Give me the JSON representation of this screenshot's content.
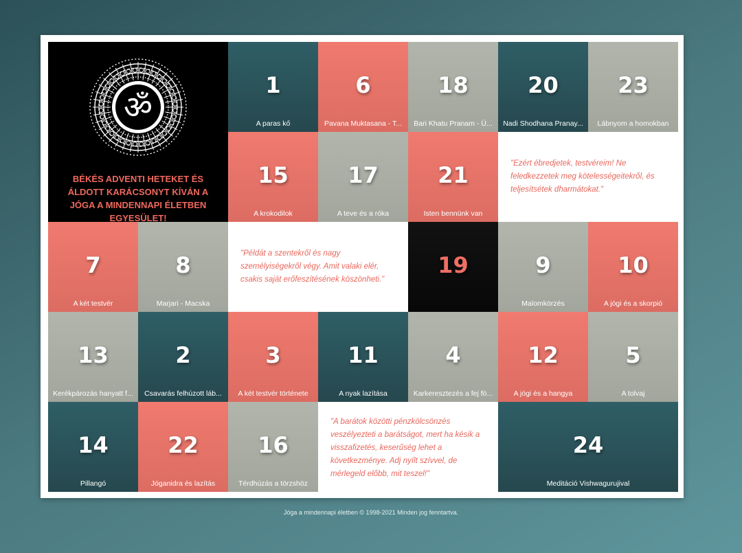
{
  "hero": {
    "logo_icon": "om-mandala-icon",
    "text": "BÉKÉS ADVENTI HETEKET ÉS ÁLDOTT KARÁCSONYT KÍVÁN A JÓGA A MINDENNAPI ÉLETBEN EGYESÜLET!"
  },
  "tiles": [
    {
      "number": "1",
      "label": "A paras kő",
      "color": "teal"
    },
    {
      "number": "6",
      "label": "Pavana Muktasana - T...",
      "color": "coral"
    },
    {
      "number": "18",
      "label": "Bari Khatu Pranam - Ü...",
      "color": "gray"
    },
    {
      "number": "20",
      "label": "Nadi Shodhana Pranay...",
      "color": "teal"
    },
    {
      "number": "23",
      "label": "Lábnyom a homokban",
      "color": "gray"
    },
    {
      "number": "15",
      "label": "A krokodilok",
      "color": "coral"
    },
    {
      "number": "17",
      "label": "A teve és a róka",
      "color": "gray"
    },
    {
      "number": "21",
      "label": "Isten bennünk van",
      "color": "coral"
    },
    {
      "number": "7",
      "label": "A két testvér",
      "color": "coral"
    },
    {
      "number": "8",
      "label": "Marjari - Macska",
      "color": "gray"
    },
    {
      "number": "19",
      "label": "",
      "color": "dark"
    },
    {
      "number": "9",
      "label": "Malomkörzés",
      "color": "gray"
    },
    {
      "number": "10",
      "label": "A jógi és a skorpió",
      "color": "coral"
    },
    {
      "number": "13",
      "label": "Kerékpározás hanyatt f...",
      "color": "gray"
    },
    {
      "number": "2",
      "label": "Csavarás felhúzott láb...",
      "color": "teal"
    },
    {
      "number": "3",
      "label": "A két testvér története",
      "color": "coral"
    },
    {
      "number": "11",
      "label": "A nyak lazítása",
      "color": "teal"
    },
    {
      "number": "4",
      "label": "Karkeresztezés a fej fö...",
      "color": "gray"
    },
    {
      "number": "12",
      "label": "A jógi és a hangya",
      "color": "coral"
    },
    {
      "number": "5",
      "label": "A tolvaj",
      "color": "gray"
    },
    {
      "number": "14",
      "label": "Pillangó",
      "color": "teal"
    },
    {
      "number": "22",
      "label": "Jóganidra és lazítás",
      "color": "coral"
    },
    {
      "number": "16",
      "label": "Térdhúzás a törzshöz",
      "color": "gray"
    },
    {
      "number": "24",
      "label": "Meditáció Vishwagurujival",
      "color": "teal"
    }
  ],
  "quotes": [
    "\"Ezért ébredjetek, testvéreim! Ne feledkezzetek meg kötelességeitekről, és teljesítsétek dharmátokat.\"",
    "\"Példát a szentekről és nagy személyiségekről végy. Amit valaki elér, csakis saját erőfeszítésének köszönheti.\"",
    "\"A barátok közötti pénzkölcsönzés veszélyezteti a barátságot, mert ha késik a visszafizetés, keserűség lehet a következménye. Adj nyílt szívvel, de mérlegeld előbb, mit teszel!\""
  ],
  "footer": "Jóga a mindennapi életben © 1998-2021 Minden jog fenntartva.",
  "colors": {
    "teal": "#2b555c",
    "coral": "#ea7268",
    "gray": "#a9ada3",
    "dark": "#0c0c0c",
    "accent_text": "#f0695e"
  }
}
